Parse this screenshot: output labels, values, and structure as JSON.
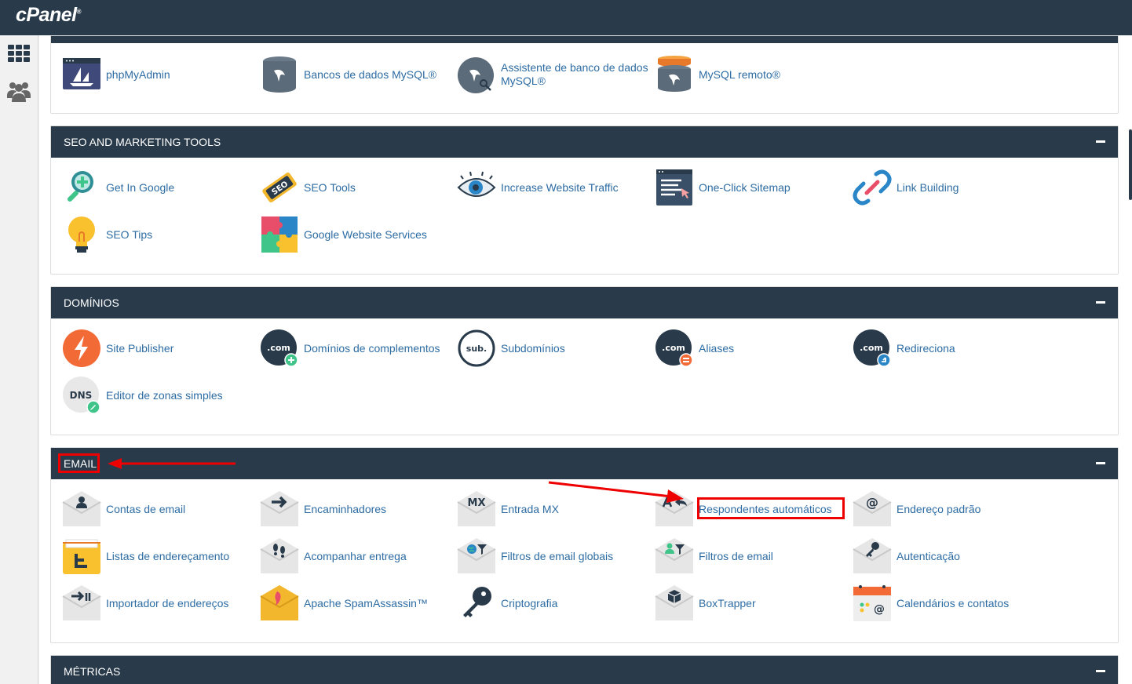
{
  "app": {
    "logo": "cPanel",
    "logo_mark": "®"
  },
  "sidebar": {
    "items": [
      {
        "icon": "grid-icon"
      },
      {
        "icon": "users-icon"
      }
    ]
  },
  "colors": {
    "header": "#293a4a",
    "link": "#2d6ca3",
    "highlight": "#e00000"
  },
  "databases": {
    "items": [
      {
        "label": "phpMyAdmin",
        "icon": "phpmyadmin-icon"
      },
      {
        "label": "Bancos de dados MySQL®",
        "icon": "mysql-databases-icon"
      },
      {
        "label": "Assistente de banco de dados MySQL®",
        "icon": "mysql-wizard-icon"
      },
      {
        "label": "MySQL remoto®",
        "icon": "remote-mysql-icon"
      }
    ]
  },
  "seo": {
    "title": "SEO AND MARKETING TOOLS",
    "items": [
      {
        "label": "Get In Google",
        "icon": "get-in-google-icon"
      },
      {
        "label": "SEO Tools",
        "icon": "seo-tools-icon"
      },
      {
        "label": "Increase Website Traffic",
        "icon": "eye-icon"
      },
      {
        "label": "One-Click Sitemap",
        "icon": "sitemap-icon"
      },
      {
        "label": "Link Building",
        "icon": "link-icon"
      },
      {
        "label": "SEO Tips",
        "icon": "lightbulb-icon"
      },
      {
        "label": "Google Website Services",
        "icon": "puzzle-icon"
      }
    ]
  },
  "domains": {
    "title": "DOMÍNIOS",
    "items": [
      {
        "label": "Site Publisher",
        "icon": "lightning-icon"
      },
      {
        "label": "Domínios de complementos",
        "icon": "addon-domains-icon",
        "glyph": ".com"
      },
      {
        "label": "Subdomínios",
        "icon": "subdomains-icon",
        "glyph": "sub."
      },
      {
        "label": "Aliases",
        "icon": "aliases-icon",
        "glyph": ".com"
      },
      {
        "label": "Redireciona",
        "icon": "redirects-icon",
        "glyph": ".com"
      },
      {
        "label": "Editor de zonas simples",
        "icon": "dns-icon",
        "glyph": "DNS"
      }
    ]
  },
  "email": {
    "title": "EMAIL",
    "items": [
      {
        "label": "Contas de email",
        "icon": "email-accounts-icon"
      },
      {
        "label": "Encaminhadores",
        "icon": "forwarders-icon"
      },
      {
        "label": "Entrada MX",
        "icon": "mx-entry-icon",
        "glyph": "MX"
      },
      {
        "label": "Respondentes automáticos",
        "icon": "autoresponders-icon"
      },
      {
        "label": "Endereço padrão",
        "icon": "default-address-icon",
        "glyph": "@"
      },
      {
        "label": "Listas de endereçamento",
        "icon": "mailing-lists-icon"
      },
      {
        "label": "Acompanhar entrega",
        "icon": "track-delivery-icon"
      },
      {
        "label": "Filtros de email globais",
        "icon": "global-filters-icon"
      },
      {
        "label": "Filtros de email",
        "icon": "email-filters-icon"
      },
      {
        "label": "Autenticação",
        "icon": "authentication-icon"
      },
      {
        "label": "Importador de endereços",
        "icon": "address-importer-icon"
      },
      {
        "label": "Apache SpamAssassin™",
        "icon": "spamassassin-icon"
      },
      {
        "label": "Criptografia",
        "icon": "key-icon"
      },
      {
        "label": "BoxTrapper",
        "icon": "boxtrapper-icon"
      },
      {
        "label": "Calendários e contatos",
        "icon": "calendar-icon"
      }
    ]
  },
  "metrics": {
    "title": "MÉTRICAS"
  }
}
